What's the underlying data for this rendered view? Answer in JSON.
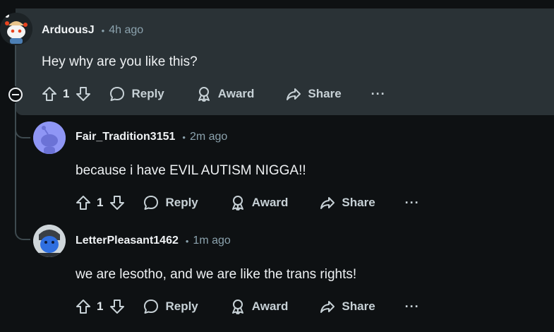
{
  "comments": [
    {
      "username": "ArduousJ",
      "time": "4h ago",
      "text": "Hey why are you like this?",
      "votes": "1",
      "reply_label": "Reply",
      "award_label": "Award",
      "share_label": "Share",
      "more_label": "···"
    },
    {
      "username": "Fair_Tradition3151",
      "time": "2m ago",
      "text": "because i have EVIL AUTISM NIGGA!!",
      "votes": "1",
      "reply_label": "Reply",
      "award_label": "Award",
      "share_label": "Share",
      "more_label": "···"
    },
    {
      "username": "LetterPleasant1462",
      "time": "1m ago",
      "text": "we are lesotho, and we are like the trans rights!",
      "votes": "1",
      "reply_label": "Reply",
      "award_label": "Award",
      "share_label": "Share",
      "more_label": "···"
    }
  ],
  "separator": "•",
  "colors": {
    "background": "#0e1113",
    "highlight": "#2a3236",
    "thread_line": "#3e4a4f",
    "muted_text": "#8ba2ad"
  }
}
